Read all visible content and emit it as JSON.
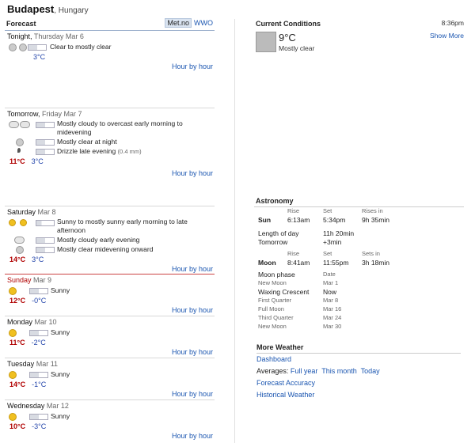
{
  "header": {
    "city": "Budapest",
    "country": ", Hungary"
  },
  "forecast": {
    "label": "Forecast",
    "source_selected": "Met.no",
    "source_alt": "WWO",
    "hour_link": "Hour by hour",
    "days": [
      {
        "day": "Tonight,",
        "date": "Thursday Mar 6",
        "lines": [
          "Clear to mostly clear"
        ],
        "hi": "",
        "lo": "3°C"
      },
      {
        "day": "Tomorrow,",
        "date": "Friday Mar 7",
        "lines": [
          "Mostly cloudy to overcast early morning to midevening",
          "Mostly clear at night",
          "Drizzle late evening"
        ],
        "extra": "(0.4 mm)",
        "hi": "11°C",
        "lo": "3°C"
      },
      {
        "day": "Saturday",
        "date": "Mar 8",
        "lines": [
          "Sunny to mostly sunny early morning to late afternoon",
          "Mostly cloudy early evening",
          "Mostly clear midevening onward"
        ],
        "hi": "14°C",
        "lo": "3°C"
      },
      {
        "day": "Sunday",
        "date": "Mar 9",
        "lines": [
          "Sunny"
        ],
        "hi": "12°C",
        "lo": "-0°C"
      },
      {
        "day": "Monday",
        "date": "Mar 10",
        "lines": [
          "Sunny"
        ],
        "hi": "11°C",
        "lo": "-2°C"
      },
      {
        "day": "Tuesday",
        "date": "Mar 11",
        "lines": [
          "Sunny"
        ],
        "hi": "14°C",
        "lo": "-1°C"
      },
      {
        "day": "Wednesday",
        "date": "Mar 12",
        "lines": [
          "Sunny"
        ],
        "hi": "10°C",
        "lo": "-3°C"
      }
    ]
  },
  "current": {
    "label": "Current Conditions",
    "time": "8:36pm",
    "temp": "9°C",
    "desc": "Mostly clear",
    "more": "Show More"
  },
  "astronomy": {
    "label": "Astronomy",
    "h_rise": "Rise",
    "h_set": "Set",
    "h_rises_in": "Rises in",
    "h_sets_in": "Sets in",
    "sun": {
      "name": "Sun",
      "rise": "6:13am",
      "set": "5:34pm",
      "rises_in": "9h 35min"
    },
    "length_label": "Length of day",
    "length": "11h 20min",
    "tomorrow_label": "Tomorrow",
    "tomorrow": "+3min",
    "moon": {
      "name": "Moon",
      "rise": "8:41am",
      "set": "11:55pm",
      "sets_in": "3h 18min"
    },
    "phase_label": "Moon phase",
    "date_label": "Date",
    "phases": [
      {
        "name": "New Moon",
        "date": "Mar 1"
      },
      {
        "name": "Waxing Crescent",
        "date": "Now"
      },
      {
        "name": "First Quarter",
        "date": "Mar 8"
      },
      {
        "name": "Full Moon",
        "date": "Mar 16"
      },
      {
        "name": "Third Quarter",
        "date": "Mar 24"
      },
      {
        "name": "New Moon",
        "date": "Mar 30"
      }
    ]
  },
  "more_weather": {
    "label": "More Weather",
    "dashboard": "Dashboard",
    "averages": "Averages:",
    "full_year": "Full year",
    "this_month": "This month",
    "today": "Today",
    "accuracy": "Forecast Accuracy",
    "historical": "Historical Weather"
  }
}
